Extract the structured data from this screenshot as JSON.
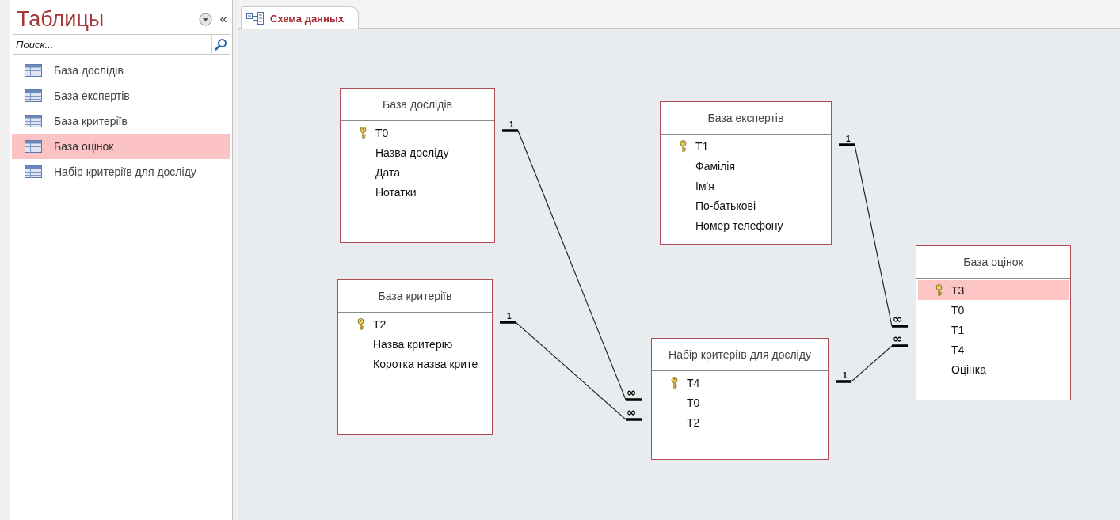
{
  "navigation_pane": {
    "title": "Таблицы",
    "collapse": "«",
    "search": {
      "placeholder": "Поиск..."
    },
    "items": [
      {
        "label": "База дослідів",
        "selected": false
      },
      {
        "label": "База експертів",
        "selected": false
      },
      {
        "label": "База критеріїв",
        "selected": false
      },
      {
        "label": "База оцінок",
        "selected": true
      },
      {
        "label": "Набір критеріїв для досліду",
        "selected": false
      }
    ]
  },
  "tabs": [
    {
      "label": "Схема данных",
      "selected": true
    }
  ],
  "diagram": {
    "tables": [
      {
        "title": "База дослідів",
        "fields": [
          {
            "name": "T0",
            "primary_key": true,
            "selected": false
          },
          {
            "name": "Назва досліду",
            "primary_key": false,
            "selected": false
          },
          {
            "name": "Дата",
            "primary_key": false,
            "selected": false
          },
          {
            "name": "Нотатки",
            "primary_key": false,
            "selected": false
          }
        ]
      },
      {
        "title": "База експертів",
        "fields": [
          {
            "name": "T1",
            "primary_key": true,
            "selected": false
          },
          {
            "name": "Фамілія",
            "primary_key": false,
            "selected": false
          },
          {
            "name": "Ім'я",
            "primary_key": false,
            "selected": false
          },
          {
            "name": "По-батькові",
            "primary_key": false,
            "selected": false
          },
          {
            "name": "Номер телефону",
            "primary_key": false,
            "selected": false
          }
        ]
      },
      {
        "title": "База критеріїв",
        "fields": [
          {
            "name": "T2",
            "primary_key": true,
            "selected": false
          },
          {
            "name": "Назва критерію",
            "primary_key": false,
            "selected": false
          },
          {
            "name": "Коротка назва крите",
            "primary_key": false,
            "selected": false
          }
        ]
      },
      {
        "title": "Набір критеріїв для досліду",
        "fields": [
          {
            "name": "T4",
            "primary_key": true,
            "selected": false
          },
          {
            "name": "T0",
            "primary_key": false,
            "selected": false
          },
          {
            "name": "T2",
            "primary_key": false,
            "selected": false
          }
        ]
      },
      {
        "title": "База оцінок",
        "fields": [
          {
            "name": "T3",
            "primary_key": true,
            "selected": true
          },
          {
            "name": "T0",
            "primary_key": false,
            "selected": false
          },
          {
            "name": "T1",
            "primary_key": false,
            "selected": false
          },
          {
            "name": "T4",
            "primary_key": false,
            "selected": false
          },
          {
            "name": "Оцінка",
            "primary_key": false,
            "selected": false
          }
        ]
      }
    ],
    "relationships": [
      {
        "one_label": "1",
        "many_label": "∞"
      },
      {
        "one_label": "1",
        "many_label": "∞"
      },
      {
        "one_label": "1",
        "many_label": "∞"
      },
      {
        "one_label": "1",
        "many_label": "∞"
      }
    ]
  }
}
